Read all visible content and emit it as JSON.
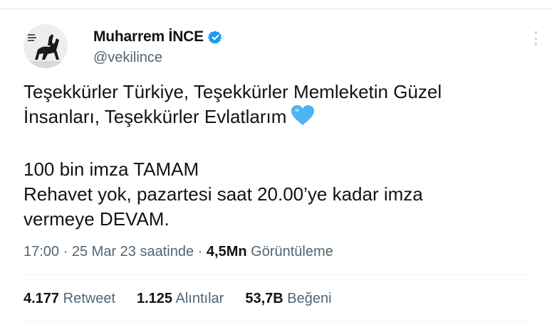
{
  "author": {
    "name": "Muharrem İNCE",
    "handle": "@vekilince",
    "verified": true,
    "badge_color": "#1d9bf0"
  },
  "tweet": {
    "lines_paragraph1": [
      "Teşekkürler Türkiye, Teşekkürler Memleketin Güzel",
      "İnsanları, Teşekkürler Evlatlarım"
    ],
    "emoji": "blue-heart-icon",
    "lines_paragraph2": [
      "100 bin imza TAMAM",
      "Rehavet yok, pazartesi saat 20.00’ye kadar imza",
      "vermeye DEVAM."
    ]
  },
  "meta": {
    "time": "17:00",
    "separator": "·",
    "date": "25 Mar 23 saatinde",
    "views_count": "4,5Mn",
    "views_label": "Görüntüleme"
  },
  "stats": {
    "retweets_count": "4.177",
    "retweets_label": "Retweet",
    "quotes_count": "1.125",
    "quotes_label": "Alıntılar",
    "likes_count": "53,7B",
    "likes_label": "Beğeni"
  },
  "colors": {
    "text": "#0f1419",
    "secondary": "#536471",
    "heart": "#4fb3f2"
  }
}
